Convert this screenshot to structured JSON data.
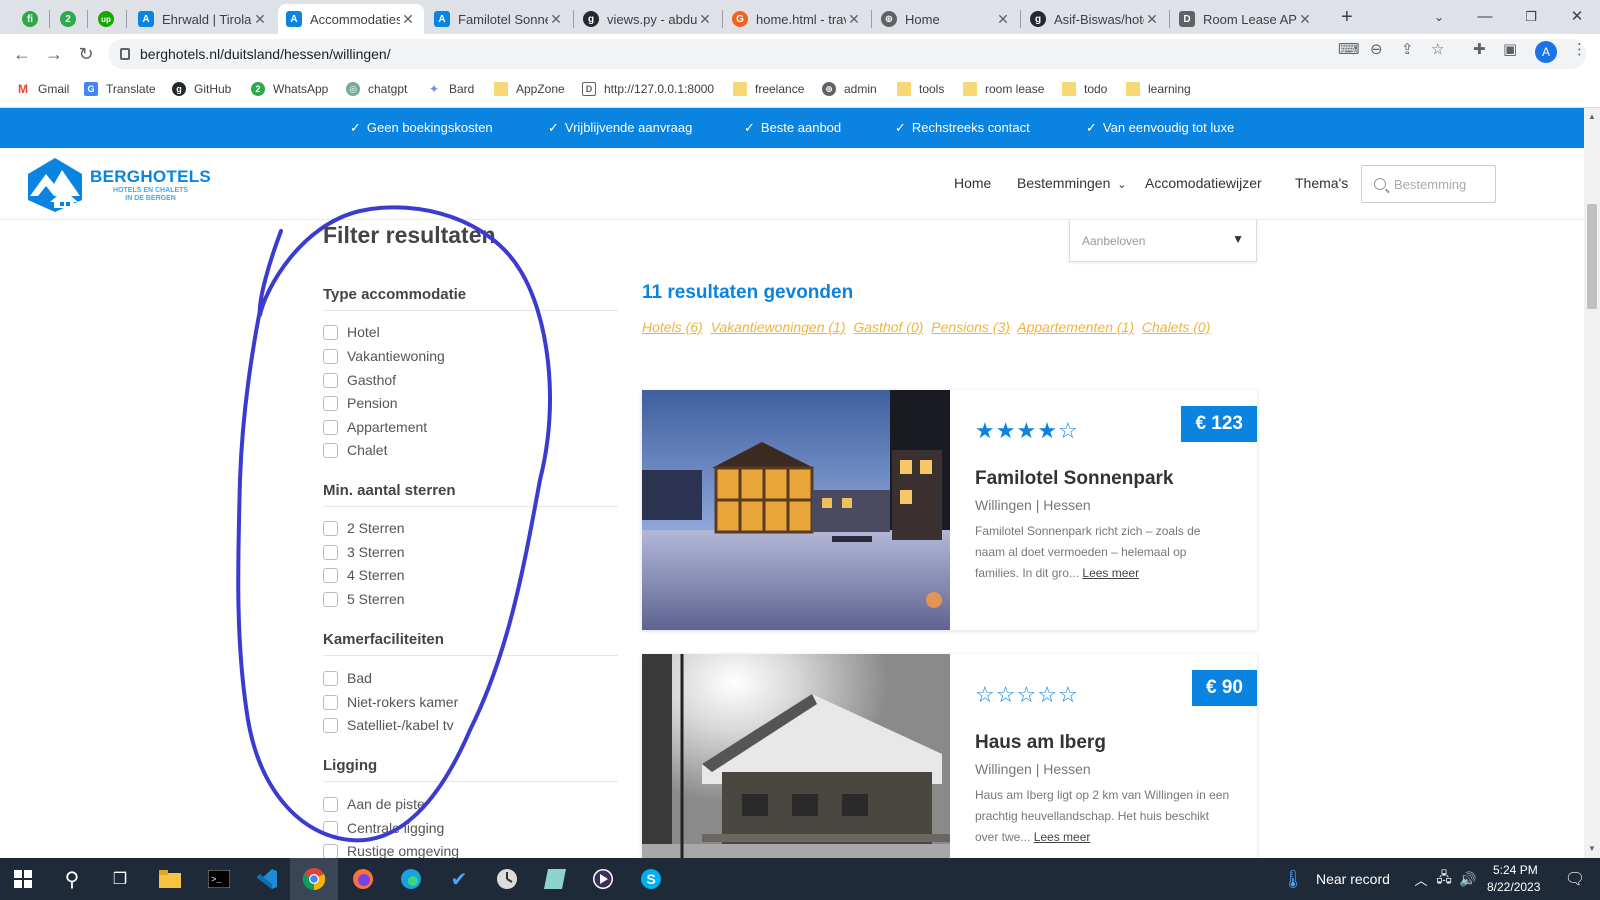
{
  "browser": {
    "tabs": [
      {
        "title": "",
        "favicon": "fi",
        "color": "#2ea84a"
      },
      {
        "title": "",
        "favicon": "2",
        "color": "#2ea84a"
      },
      {
        "title": "",
        "favicon": "up",
        "color": "#14a800"
      },
      {
        "title": "Ehrwald | Tirolal",
        "favicon": "A",
        "color": "#0a84e0"
      },
      {
        "title": "Accommodaties",
        "favicon": "A",
        "color": "#0a84e0",
        "active": true
      },
      {
        "title": "Familotel Sonne",
        "favicon": "A",
        "color": "#0a84e0"
      },
      {
        "title": "views.py - abdur",
        "favicon": "g",
        "color": "#24292e"
      },
      {
        "title": "home.html - trav",
        "favicon": "G",
        "color": "#f26322"
      },
      {
        "title": "Home",
        "favicon": "⊕",
        "color": "#5f6368"
      },
      {
        "title": "Asif-Biswas/hote",
        "favicon": "g",
        "color": "#24292e"
      },
      {
        "title": "Room Lease API",
        "favicon": "D",
        "color": "#5f6368"
      }
    ],
    "url": "berghotels.nl/duitsland/hessen/willingen/",
    "profile_initial": "A",
    "bookmarks": [
      {
        "label": "Gmail",
        "icon": "M",
        "color": "#ea4335"
      },
      {
        "label": "Translate",
        "icon": "G",
        "color": "#4285f4"
      },
      {
        "label": "GitHub",
        "icon": "g",
        "color": "#24292e"
      },
      {
        "label": "WhatsApp",
        "icon": "2",
        "color": "#2ea84a"
      },
      {
        "label": "chatgpt",
        "icon": "◎",
        "color": "#74aa9c"
      },
      {
        "label": "Bard",
        "icon": "✦",
        "color": "#6b8cf5"
      },
      {
        "label": "AppZone",
        "icon": "",
        "color": "folder"
      },
      {
        "label": "http://127.0.0.1:8000",
        "icon": "D",
        "color": "#5f6368"
      },
      {
        "label": "freelance",
        "icon": "",
        "color": "folder"
      },
      {
        "label": "admin",
        "icon": "⊕",
        "color": "#5f6368"
      },
      {
        "label": "tools",
        "icon": "",
        "color": "folder"
      },
      {
        "label": "room lease",
        "icon": "",
        "color": "folder"
      },
      {
        "label": "todo",
        "icon": "",
        "color": "folder"
      },
      {
        "label": "learning",
        "icon": "",
        "color": "folder"
      }
    ]
  },
  "site": {
    "usps": [
      "Geen boekingskosten",
      "Vrijblijvende aanvraag",
      "Beste aanbod",
      "Rechstreeks contact",
      "Van eenvoudig tot luxe"
    ],
    "logo": {
      "name": "BERGHOTELS",
      "tagline1": "HOTELS EN CHALETS",
      "tagline2": "IN DE BERGEN"
    },
    "nav": {
      "home": "Home",
      "destinations": "Bestemmingen",
      "guide": "Accomodatiewijzer",
      "themes": "Thema's"
    },
    "search_placeholder": "Bestemming",
    "sort_value": "Aanbeloven",
    "accent": "#0a84e0",
    "link_color": "#f0b43a"
  },
  "filters": {
    "title": "Filter resultaten",
    "groups": [
      {
        "title": "Type accommodatie",
        "options": [
          "Hotel",
          "Vakantiewoning",
          "Gasthof",
          "Pension",
          "Appartement",
          "Chalet"
        ]
      },
      {
        "title": "Min. aantal sterren",
        "options": [
          "2 Sterren",
          "3 Sterren",
          "4 Sterren",
          "5 Sterren"
        ]
      },
      {
        "title": "Kamerfaciliteiten",
        "options": [
          "Bad",
          "Niet-rokers kamer",
          "Satelliet-/kabel tv"
        ]
      },
      {
        "title": "Ligging",
        "options": [
          "Aan de piste",
          "Centrale ligging",
          "Rustige omgeving"
        ]
      }
    ]
  },
  "results": {
    "count_label": "11 resultaten gevonden",
    "type_links": [
      "Hotels (6)",
      "Vakantiewoningen (1)",
      "Gasthof (0)",
      "Pensions (3)",
      "Appartementen (1)",
      "Chalets (0)"
    ],
    "items": [
      {
        "price": "€ 123",
        "stars": 4,
        "name": "Familotel Sonnenpark",
        "location": "Willingen | Hessen",
        "description": "Familotel Sonnenpark richt zich – zoals de naam al doet vermoeden – helemaal op families. In dit gro...",
        "more": "Lees meer"
      },
      {
        "price": "€ 90",
        "stars": 0,
        "name": "Haus am Iberg",
        "location": "Willingen | Hessen",
        "description": "Haus am Iberg ligt op 2 km van Willingen in een prachtig heuvellandschap. Het huis beschikt over twe...",
        "more": "Lees meer"
      }
    ]
  },
  "taskbar": {
    "weather": "Near record",
    "time": "5:24 PM",
    "date": "8/22/2023"
  }
}
